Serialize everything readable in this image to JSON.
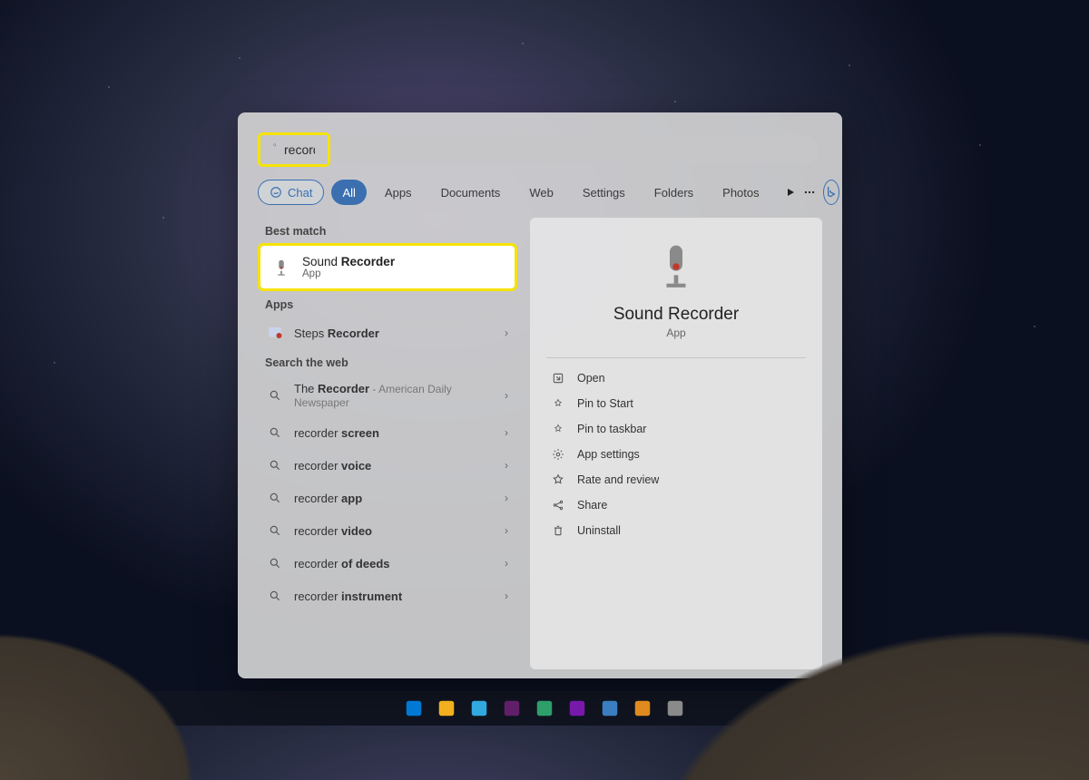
{
  "search": {
    "value": "recorder"
  },
  "filters": {
    "chat": "Chat",
    "tabs": [
      "All",
      "Apps",
      "Documents",
      "Web",
      "Settings",
      "Folders",
      "Photos"
    ],
    "active_index": 0
  },
  "left": {
    "best_match_label": "Best match",
    "best_match": {
      "prefix": "Sound ",
      "bold": "Recorder",
      "subtitle": "App"
    },
    "apps_label": "Apps",
    "apps": [
      {
        "prefix": "Steps ",
        "bold": "Recorder"
      }
    ],
    "web_label": "Search the web",
    "web": [
      {
        "prefix": "The ",
        "bold": "Recorder",
        "hint": " - American Daily Newspaper"
      },
      {
        "prefix": "recorder ",
        "bold": "screen"
      },
      {
        "prefix": "recorder ",
        "bold": "voice"
      },
      {
        "prefix": "recorder ",
        "bold": "app"
      },
      {
        "prefix": "recorder ",
        "bold": "video"
      },
      {
        "prefix": "recorder ",
        "bold": "of deeds"
      },
      {
        "prefix": "recorder ",
        "bold": "instrument"
      }
    ]
  },
  "right": {
    "title": "Sound Recorder",
    "kind": "App",
    "actions": [
      {
        "icon": "open",
        "label": "Open"
      },
      {
        "icon": "pin",
        "label": "Pin to Start"
      },
      {
        "icon": "pin",
        "label": "Pin to taskbar"
      },
      {
        "icon": "settings",
        "label": "App settings"
      },
      {
        "icon": "star",
        "label": "Rate and review"
      },
      {
        "icon": "share",
        "label": "Share"
      },
      {
        "icon": "trash",
        "label": "Uninstall"
      }
    ]
  },
  "taskbar": [
    {
      "name": "start",
      "color": "#0078d4"
    },
    {
      "name": "file-explorer",
      "color": "#f2b01e"
    },
    {
      "name": "edge",
      "color": "#31a8e0"
    },
    {
      "name": "slack",
      "color": "#611f69"
    },
    {
      "name": "teams",
      "color": "#2e9e6b"
    },
    {
      "name": "onenote",
      "color": "#7719aa"
    },
    {
      "name": "notepad",
      "color": "#3a7ec1"
    },
    {
      "name": "snip",
      "color": "#e08b1e"
    },
    {
      "name": "sound-recorder",
      "color": "#8a8a8a"
    }
  ]
}
